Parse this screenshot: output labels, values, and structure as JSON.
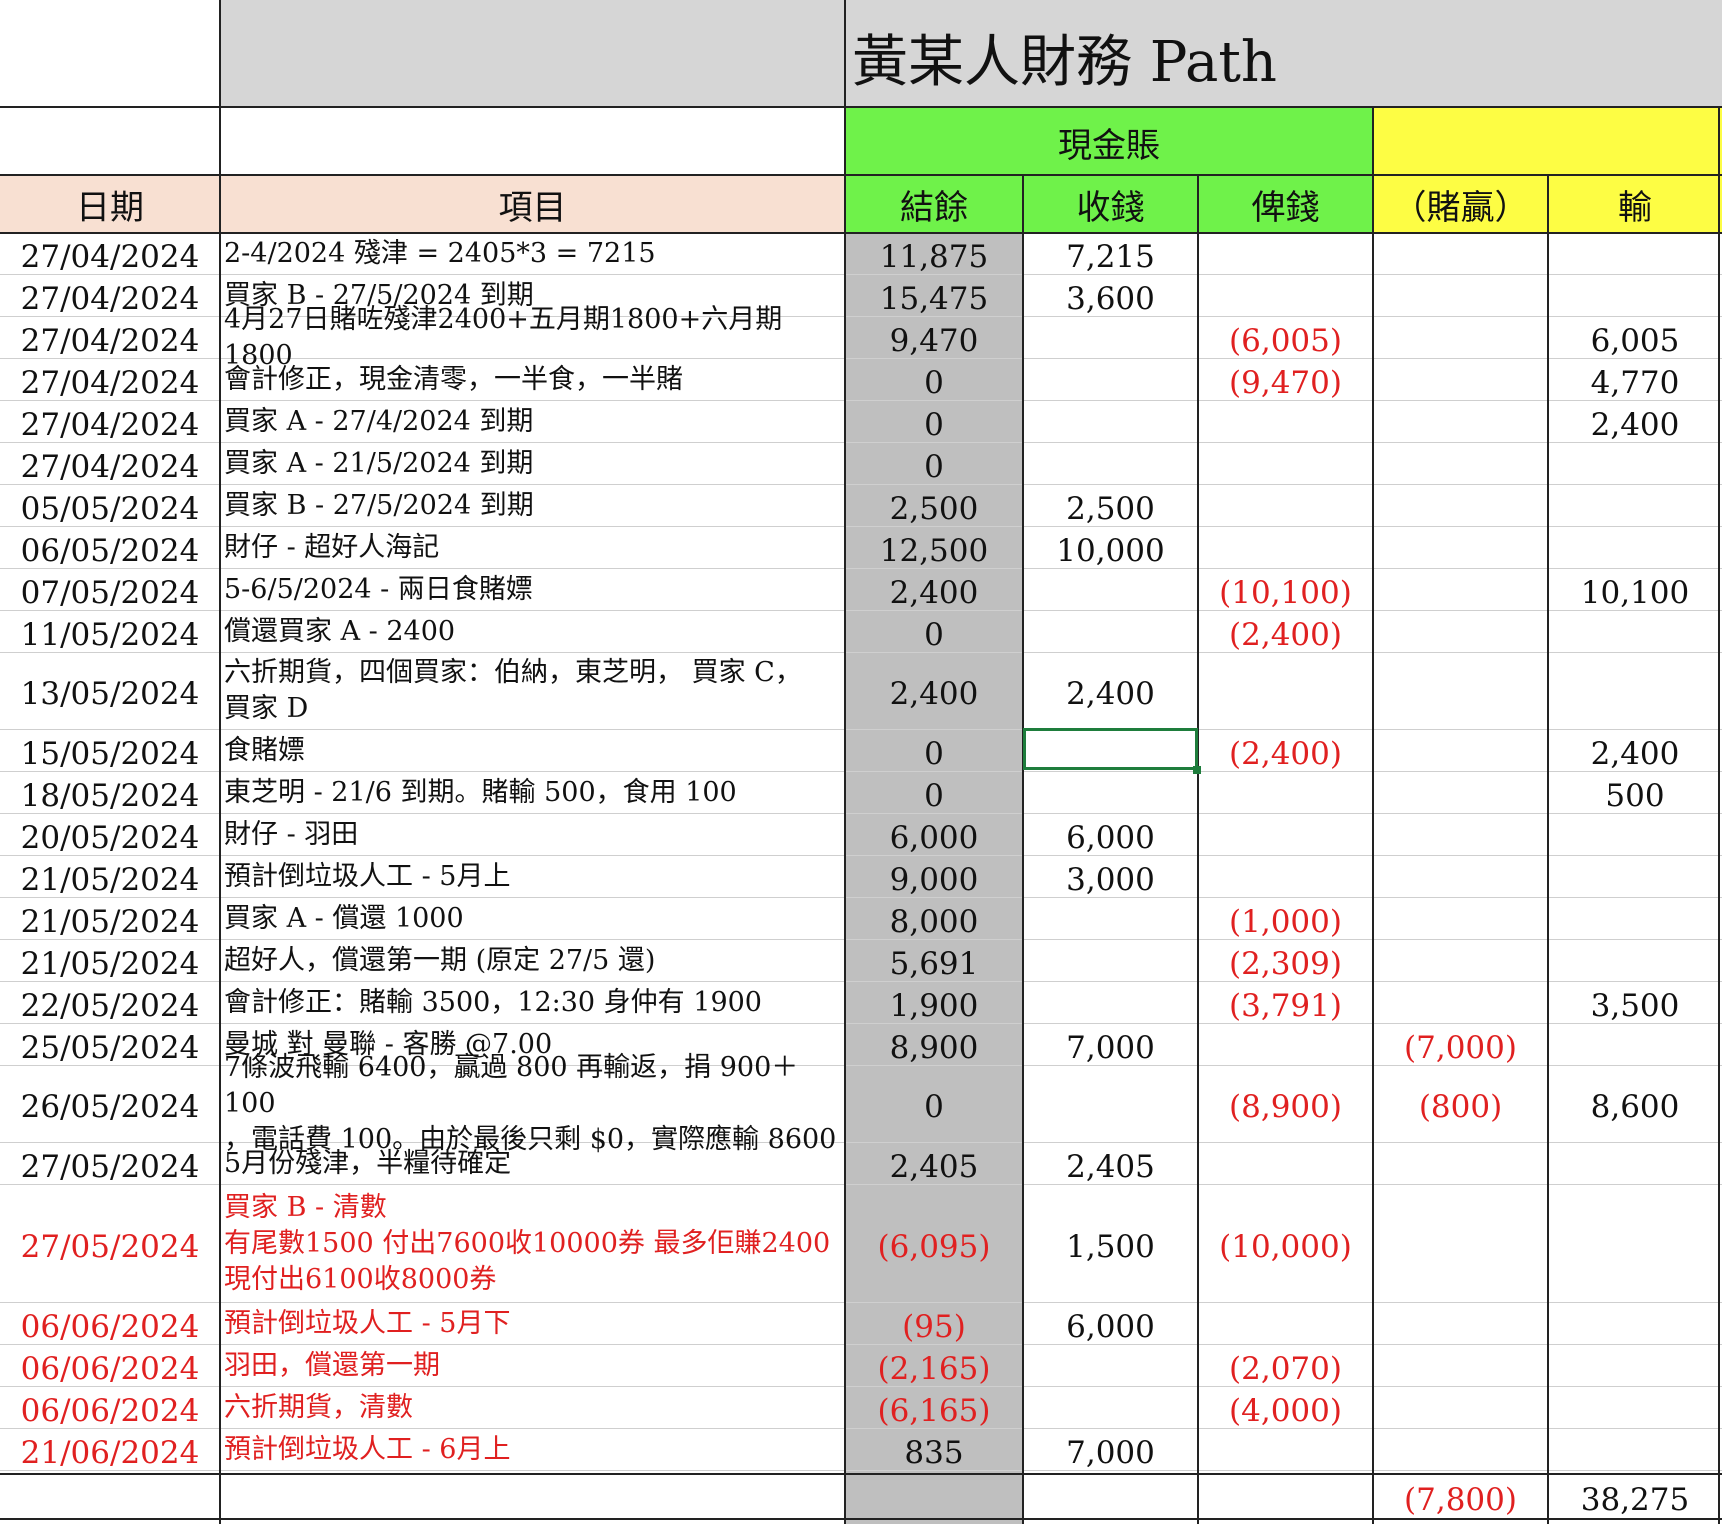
{
  "sheet": {
    "title": "黃某人財務 Path",
    "section_cash": "現金賬",
    "section_gamble": "",
    "headers": {
      "date": "日期",
      "item": "項目",
      "balance": "結餘",
      "income": "收錢",
      "payout": "俾錢",
      "win": "（賭贏）",
      "lose": "輸"
    },
    "colors": {
      "green": "#6ff24a",
      "yellow": "#fdfd44",
      "peach": "#f8e0d2",
      "gray": "#bfbfbf",
      "negative": "#e02020",
      "selection": "#1e7d3c"
    },
    "rows": [
      {
        "date": "27/04/2024",
        "item": "2-4/2024 殘津 = 2405*3 = 7215",
        "balance": "11,875",
        "income": "7,215",
        "payout": "",
        "win": "",
        "lose": "",
        "red": false
      },
      {
        "date": "27/04/2024",
        "item": "買家 B - 27/5/2024 到期",
        "balance": "15,475",
        "income": "3,600",
        "payout": "",
        "win": "",
        "lose": "",
        "red": false
      },
      {
        "date": "27/04/2024",
        "item": " 4月27日賭咗殘津2400+五月期1800+六月期1800",
        "balance": "9,470",
        "income": "",
        "payout": "(6,005)",
        "win": "",
        "lose": "6,005",
        "red": false
      },
      {
        "date": "27/04/2024",
        "item": "會計修正，現金清零，一半食，一半賭",
        "balance": "0",
        "income": "",
        "payout": "(9,470)",
        "win": "",
        "lose": "4,770",
        "red": false
      },
      {
        "date": "27/04/2024",
        "item": "買家 A - 27/4/2024 到期",
        "balance": "0",
        "income": "",
        "payout": "",
        "win": "",
        "lose": "2,400",
        "red": false
      },
      {
        "date": "27/04/2024",
        "item": "買家 A - 21/5/2024 到期",
        "balance": "0",
        "income": "",
        "payout": "",
        "win": "",
        "lose": "",
        "red": false
      },
      {
        "date": "05/05/2024",
        "item": "買家 B - 27/5/2024 到期",
        "balance": "2,500",
        "income": "2,500",
        "payout": "",
        "win": "",
        "lose": "",
        "red": false
      },
      {
        "date": "06/05/2024",
        "item": "財仔 - 超好人海記",
        "balance": "12,500",
        "income": "10,000",
        "payout": "",
        "win": "",
        "lose": "",
        "red": false
      },
      {
        "date": "07/05/2024",
        "item": "5-6/5/2024 - 兩日食賭嫖",
        "balance": "2,400",
        "income": "",
        "payout": "(10,100)",
        "win": "",
        "lose": "10,100",
        "red": false
      },
      {
        "date": "11/05/2024",
        "item": "償還買家 A  - 2400",
        "balance": "0",
        "income": "",
        "payout": "(2,400)",
        "win": "",
        "lose": "",
        "red": false
      },
      {
        "date": "13/05/2024",
        "item": "六折期貨，四個買家：伯納，東芝明，  買家 C，\n買家 D",
        "balance": "2,400",
        "income": "2,400",
        "payout": "",
        "win": "",
        "lose": "",
        "red": false
      },
      {
        "date": "15/05/2024",
        "item": "食賭嫖",
        "balance": "0",
        "income": "",
        "payout": "(2,400)",
        "win": "",
        "lose": "2,400",
        "red": false
      },
      {
        "date": "18/05/2024",
        "item": "東芝明 - 21/6 到期。賭輸 500，食用 100",
        "balance": "0",
        "income": "",
        "payout": "",
        "win": "",
        "lose": "500",
        "red": false
      },
      {
        "date": "20/05/2024",
        "item": "財仔 - 羽田",
        "balance": "6,000",
        "income": "6,000",
        "payout": "",
        "win": "",
        "lose": "",
        "red": false
      },
      {
        "date": "21/05/2024",
        "item": "預計倒垃圾人工 - 5月上",
        "balance": "9,000",
        "income": "3,000",
        "payout": "",
        "win": "",
        "lose": "",
        "red": false
      },
      {
        "date": "21/05/2024",
        "item": "買家 A - 償還 1000",
        "balance": "8,000",
        "income": "",
        "payout": "(1,000)",
        "win": "",
        "lose": "",
        "red": false
      },
      {
        "date": "21/05/2024",
        "item": "超好人，償還第一期 (原定 27/5 還)",
        "balance": "5,691",
        "income": "",
        "payout": "(2,309)",
        "win": "",
        "lose": "",
        "red": false
      },
      {
        "date": "22/05/2024",
        "item": "會計修正：賭輸 3500，12:30 身仲有 1900",
        "balance": "1,900",
        "income": "",
        "payout": "(3,791)",
        "win": "",
        "lose": "3,500",
        "red": false
      },
      {
        "date": "25/05/2024",
        "item": "曼城 對 曼聯 - 客勝 @7.00",
        "balance": "8,900",
        "income": "7,000",
        "payout": "",
        "win": "(7,000)",
        "lose": "",
        "red": false
      },
      {
        "date": "26/05/2024",
        "item": "7條波飛輸 6400，贏過 800 再輸返，捐 900＋100\n，電話費 100。由於最後只剩 $0，實際應輸 8600",
        "balance": "0",
        "income": "",
        "payout": "(8,900)",
        "win": "(800)",
        "lose": "8,600",
        "red": false
      },
      {
        "date": "27/05/2024",
        "item": "5月份殘津，半糧待確定",
        "balance": "2,405",
        "income": "2,405",
        "payout": "",
        "win": "",
        "lose": "",
        "red": false
      },
      {
        "date": "27/05/2024",
        "item": "買家 B - 清數\n有尾數1500 付出7600收10000券 最多佢賺2400\n現付出6100收8000券",
        "balance": "(6,095)",
        "income": "1,500",
        "payout": "(10,000)",
        "win": "",
        "lose": "",
        "red": true
      },
      {
        "date": "06/06/2024",
        "item": "預計倒垃圾人工 - 5月下",
        "balance": "(95)",
        "income": "6,000",
        "payout": "",
        "win": "",
        "lose": "",
        "red": true
      },
      {
        "date": "06/06/2024",
        "item": "羽田，償還第一期",
        "balance": "(2,165)",
        "income": "",
        "payout": "(2,070)",
        "win": "",
        "lose": "",
        "red": true
      },
      {
        "date": "06/06/2024",
        "item": "六折期貨，清數",
        "balance": "(6,165)",
        "income": "",
        "payout": "(4,000)",
        "win": "",
        "lose": "",
        "red": true
      },
      {
        "date": "21/06/2024",
        "item": "預計倒垃圾人工 - 6月上",
        "balance": "835",
        "income": "7,000",
        "payout": "",
        "win": "",
        "lose": "",
        "red": true
      }
    ],
    "totals": {
      "win": "(7,800)",
      "lose": "38,275"
    }
  }
}
